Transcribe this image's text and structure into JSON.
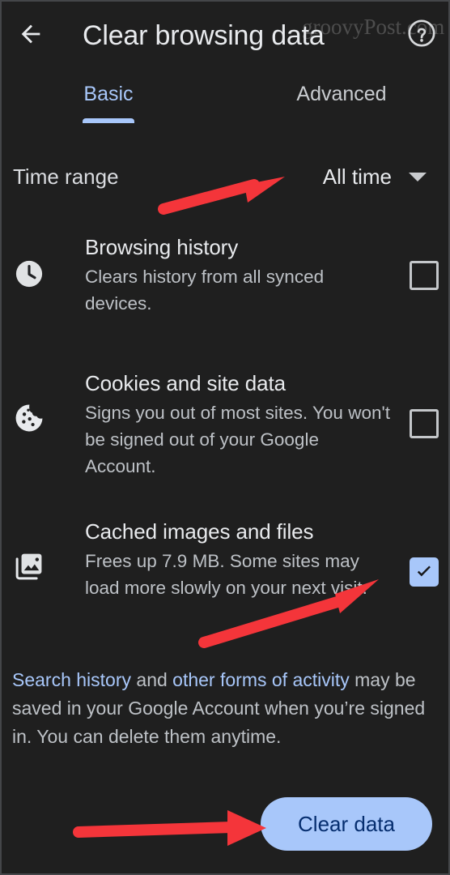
{
  "window": {
    "background_color": "#1f1f1f",
    "accent_color": "#a8c7fa"
  },
  "header": {
    "back_icon": "back-arrow-icon",
    "title": "Clear browsing data",
    "help_icon": "help-circle-icon",
    "watermark": "groovyPost.com"
  },
  "tabs": [
    {
      "label": "Basic",
      "selected": true
    },
    {
      "label": "Advanced",
      "selected": false
    }
  ],
  "time_range": {
    "label": "Time range",
    "value": "All time",
    "caret_icon": "chevron-down-icon"
  },
  "options": [
    {
      "icon": "clock-icon",
      "title": "Browsing history",
      "description": "Clears history from all synced devices.",
      "checked": false
    },
    {
      "icon": "cookie-icon",
      "title": "Cookies and site data",
      "description": "Signs you out of most sites. You won't be signed out of your Google Account.",
      "checked": false
    },
    {
      "icon": "photo-library-icon",
      "title": "Cached images and files",
      "description": "Frees up 7.9 MB. Some sites may load more slowly on your next visit.",
      "checked": true
    }
  ],
  "footer_note": {
    "link_1": "Search history",
    "middle_text": " and ",
    "link_2": "other forms of activity",
    "rest_text": " may be saved in your Google Account when you’re signed in. You can delete them anytime."
  },
  "clear_button": {
    "label": "Clear data"
  },
  "annotations": {
    "color": "#f4353a",
    "arrows": [
      {
        "name": "arrow-to-time-range",
        "points_at": "All time"
      },
      {
        "name": "arrow-to-cached-checkbox",
        "points_at": "Cached images and files checkbox"
      },
      {
        "name": "arrow-to-clear-data-button",
        "points_at": "Clear data"
      }
    ]
  }
}
